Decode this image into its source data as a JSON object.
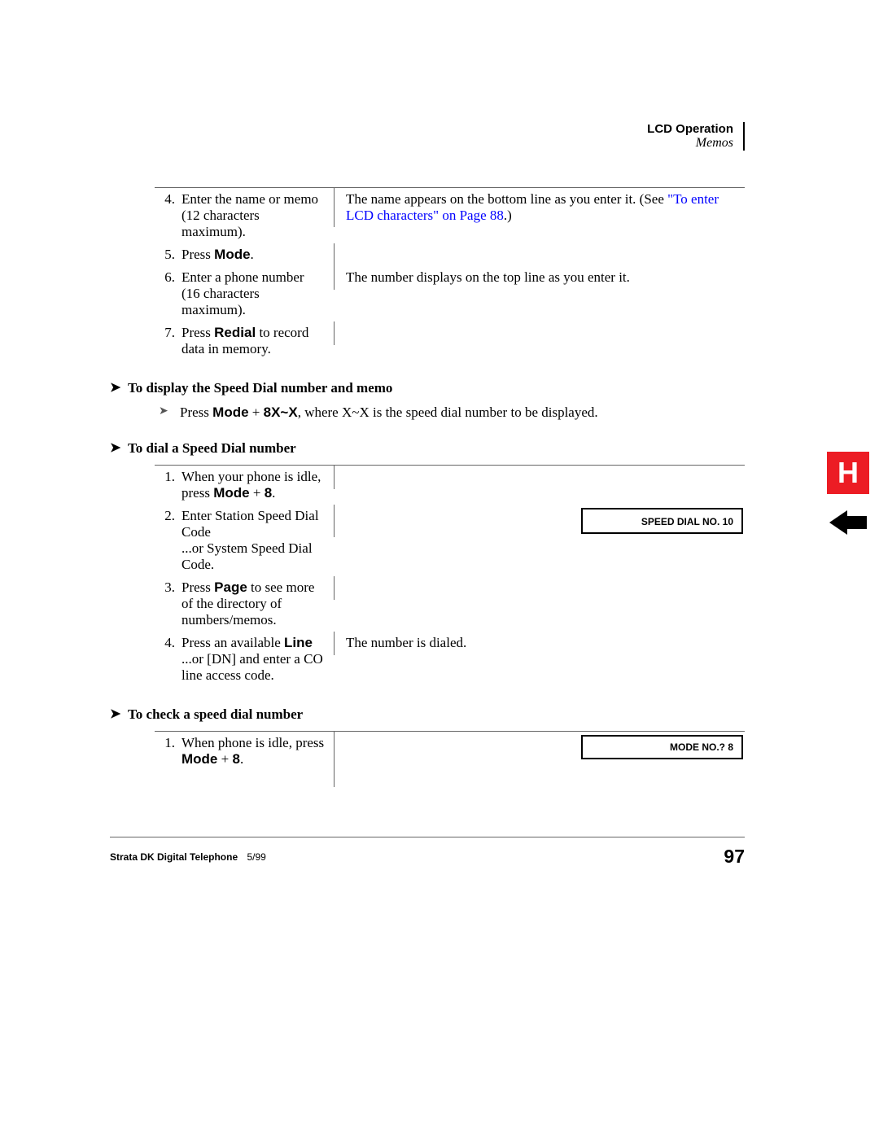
{
  "header": {
    "title": "LCD Operation",
    "subtitle": "Memos"
  },
  "table1": {
    "steps": [
      {
        "num": "4.",
        "text": "Enter the name or memo (12 characters maximum).",
        "right_pre": "The name appears on the bottom line as you enter it. (See ",
        "right_link": "\"To enter LCD characters\" on Page 88",
        "right_post": ".)"
      },
      {
        "num": "5.",
        "text_pre": "Press ",
        "text_bold": "Mode",
        "text_post": ".",
        "right": ""
      },
      {
        "num": "6.",
        "text": "Enter a phone number (16 characters maximum).",
        "right": "The number displays on the top line as you enter it."
      },
      {
        "num": "7.",
        "text_pre": "Press ",
        "text_bold": "Redial",
        "text_post": " to record data in memory.",
        "right": ""
      }
    ]
  },
  "section1": {
    "heading": "To display the Speed Dial number and memo",
    "bullet_pre": "Press ",
    "bullet_bold1": "Mode",
    "bullet_mid1": " + ",
    "bullet_bold2": "8X~X",
    "bullet_post": ", where X~X is the speed dial number to be displayed."
  },
  "section2": {
    "heading": "To dial a Speed Dial number",
    "steps": [
      {
        "num": "1.",
        "text_pre": "When your phone is idle, press ",
        "text_bold": "Mode",
        "text_mid": " + ",
        "text_bold2": "8",
        "text_post": ".",
        "right": ""
      },
      {
        "num": "2.",
        "text": "Enter Station Speed Dial Code",
        "text2": "...or System Speed Dial Code.",
        "lcd": "SPEED DIAL NO. 10"
      },
      {
        "num": "3.",
        "text_pre": "Press ",
        "text_bold": "Page",
        "text_post": " to see more of the directory of numbers/memos.",
        "right": ""
      },
      {
        "num": "4.",
        "text_pre": "Press an available ",
        "text_bold": "Line",
        "text2": "...or [DN] and enter a CO line access code.",
        "right": "The number is dialed."
      }
    ]
  },
  "section3": {
    "heading": "To check a speed dial number",
    "steps": [
      {
        "num": "1.",
        "text_pre": "When phone is idle, press ",
        "text_bold": "Mode",
        "text_mid": " + ",
        "text_bold2": "8",
        "text_post": ".",
        "lcd": "MODE NO.? 8"
      }
    ]
  },
  "footer": {
    "product": "Strata DK Digital Telephone",
    "date": "5/99",
    "page": "97"
  },
  "tab": {
    "letter": "H"
  }
}
